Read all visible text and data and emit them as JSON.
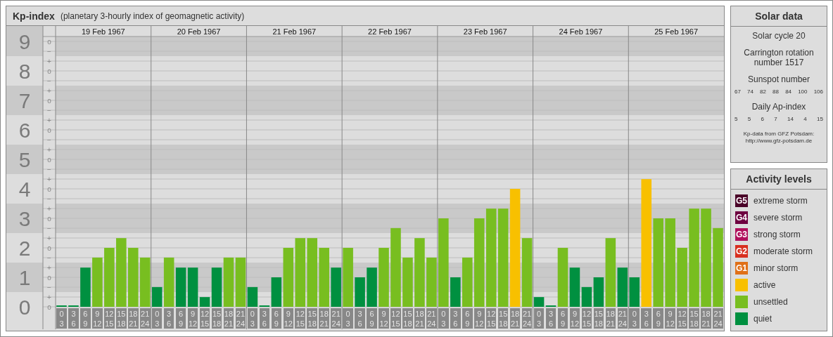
{
  "kp_panel": {
    "title": "Kp-index",
    "subtitle": "(planetary 3-hourly index of geomagnetic activity)",
    "dates": [
      "19 Feb 1967",
      "20 Feb 1967",
      "21 Feb 1967",
      "22 Feb 1967",
      "23 Feb 1967",
      "24 Feb 1967",
      "25 Feb 1967"
    ],
    "scale_marks": [
      "o",
      "−",
      "+",
      "o",
      "−",
      "+",
      "o",
      "−",
      "+",
      "o",
      "−",
      "+",
      "o",
      "−",
      "+",
      "o",
      "−",
      "+",
      "o",
      "−",
      "+",
      "o",
      "−",
      "+",
      "o",
      "−",
      "+",
      "o"
    ],
    "chart_data": {
      "type": "bar",
      "stacked": true,
      "ylim": [
        0,
        9
      ],
      "grid": true,
      "yticks": [
        {
          "value": 0,
          "label": "0"
        },
        {
          "value": 1,
          "label": "1"
        },
        {
          "value": 2,
          "label": "2"
        },
        {
          "value": 3,
          "label": "3"
        },
        {
          "value": 4,
          "label": "4"
        },
        {
          "value": 5,
          "label": "5"
        },
        {
          "value": 6,
          "label": "6"
        },
        {
          "value": 7,
          "label": "7"
        },
        {
          "value": 8,
          "label": "8"
        },
        {
          "value": 9,
          "label": "9"
        }
      ],
      "categories": [
        "0 3",
        "3 6",
        "6 9",
        "9 12",
        "12 15",
        "15 18",
        "18 21",
        "21 24",
        "0 3",
        "3 6",
        "6 9",
        "9 12",
        "12 15",
        "15 18",
        "18 21",
        "21 24",
        "0 3",
        "3 6",
        "6 9",
        "9 12",
        "12 15",
        "15 18",
        "18 21",
        "21 24",
        "0 3",
        "3 6",
        "6 9",
        "9 12",
        "12 15",
        "15 18",
        "18 21",
        "21 24",
        "0 3",
        "3 6",
        "6 9",
        "9 12",
        "12 15",
        "15 18",
        "18 21",
        "21 24",
        "0 3",
        "3 6",
        "6 9",
        "9 12",
        "12 15",
        "15 18",
        "18 21",
        "21 24",
        "0 3",
        "3 6",
        "6 9",
        "9 12",
        "12 15",
        "15 18",
        "18 21",
        "21 24"
      ],
      "series": [
        {
          "name": "quiet",
          "color": "#009040",
          "values": [
            0,
            0,
            1.33,
            null,
            null,
            null,
            null,
            null,
            0.67,
            null,
            1.33,
            1.33,
            0.33,
            1.33,
            null,
            null,
            0.67,
            0,
            1,
            null,
            null,
            null,
            null,
            1.33,
            null,
            1,
            1.33,
            null,
            null,
            null,
            null,
            null,
            null,
            1,
            null,
            null,
            null,
            null,
            null,
            null,
            0.33,
            0,
            null,
            1.33,
            0.67,
            1,
            null,
            1.33,
            1,
            null,
            null,
            null,
            null,
            null,
            null,
            null
          ]
        },
        {
          "name": "unsettled",
          "color": "#78be20",
          "values": [
            null,
            null,
            null,
            1.67,
            2,
            2.33,
            2,
            1.67,
            null,
            1.67,
            null,
            null,
            null,
            null,
            1.67,
            1.67,
            null,
            null,
            null,
            2,
            2.33,
            2.33,
            2,
            null,
            2,
            null,
            null,
            2,
            2.67,
            1.67,
            2.33,
            1.67,
            3,
            null,
            1.67,
            3,
            3.33,
            3.33,
            null,
            2.33,
            null,
            null,
            2,
            null,
            null,
            null,
            2.33,
            null,
            null,
            null,
            3,
            3,
            2,
            3.33,
            3.33,
            2.67
          ]
        },
        {
          "name": "active",
          "color": "#f8c000",
          "values": [
            null,
            null,
            null,
            null,
            null,
            null,
            null,
            null,
            null,
            null,
            null,
            null,
            null,
            null,
            null,
            null,
            null,
            null,
            null,
            null,
            null,
            null,
            null,
            null,
            null,
            null,
            null,
            null,
            null,
            null,
            null,
            null,
            null,
            null,
            null,
            null,
            null,
            null,
            4,
            null,
            null,
            null,
            null,
            null,
            null,
            null,
            null,
            null,
            null,
            4.33,
            null,
            null,
            null,
            null,
            null,
            null
          ]
        }
      ]
    }
  },
  "solar_data": {
    "title": "Solar data",
    "cycle": "Solar cycle 20",
    "carrington": "Carrington rotation number 1517",
    "sunspot_title": "Sunspot number",
    "sunspot_numbers": [
      "67",
      "74",
      "82",
      "88",
      "84",
      "100",
      "106"
    ],
    "ap_title": "Daily Ap-index",
    "ap_values": [
      "5",
      "5",
      "6",
      "7",
      "14",
      "4",
      "15"
    ],
    "source": "Kp-data from GFZ Potsdam:",
    "source_url": "http://www.gfz-potsdam.de"
  },
  "activity_levels": {
    "title": "Activity levels",
    "items": [
      {
        "badge": "G5",
        "label": "extreme storm",
        "color": "#4a0028"
      },
      {
        "badge": "G4",
        "label": "severe storm",
        "color": "#6e0040"
      },
      {
        "badge": "G3",
        "label": "strong storm",
        "color": "#b0105c"
      },
      {
        "badge": "G2",
        "label": "moderate storm",
        "color": "#d83020"
      },
      {
        "badge": "G1",
        "label": "minor storm",
        "color": "#e07018"
      }
    ]
  }
}
